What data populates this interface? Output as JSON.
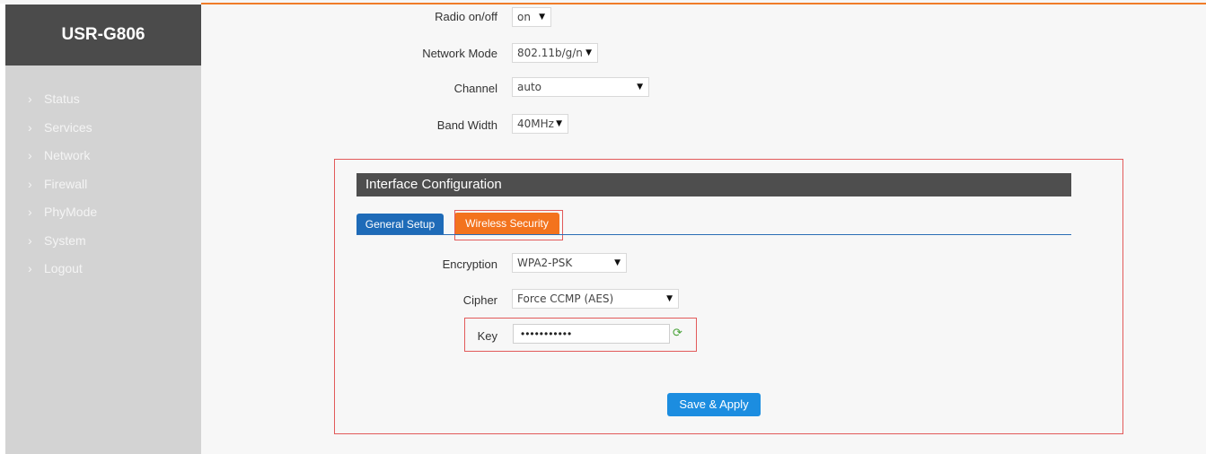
{
  "brand": "USR-G806",
  "sidebar": {
    "items": [
      {
        "label": "Status"
      },
      {
        "label": "Services"
      },
      {
        "label": "Network"
      },
      {
        "label": "Firewall"
      },
      {
        "label": "PhyMode"
      },
      {
        "label": "System"
      },
      {
        "label": "Logout"
      }
    ]
  },
  "device": {
    "radio_label": "Radio on/off",
    "radio_value": "on",
    "mode_label": "Network Mode",
    "mode_value": "802.11b/g/n",
    "channel_label": "Channel",
    "channel_value": "auto",
    "bandwidth_label": "Band Width",
    "bandwidth_value": "40MHz"
  },
  "interface": {
    "title": "Interface Configuration",
    "tabs": [
      {
        "label": "General Setup"
      },
      {
        "label": "Wireless Security"
      }
    ],
    "encryption_label": "Encryption",
    "encryption_value": "WPA2-PSK",
    "cipher_label": "Cipher",
    "cipher_value": "Force CCMP (AES)",
    "key_label": "Key",
    "key_value": "•••••••••••",
    "save_label": "Save & Apply"
  },
  "icons": {
    "dropdown": "caret-down-icon",
    "chevron": "chevron-right-icon",
    "refresh": "refresh-icon"
  },
  "colors": {
    "accent_orange": "#f3731d",
    "tab_blue": "#1e6bb8",
    "button_blue": "#1c8de0",
    "highlight_red": "#e25a5a"
  }
}
